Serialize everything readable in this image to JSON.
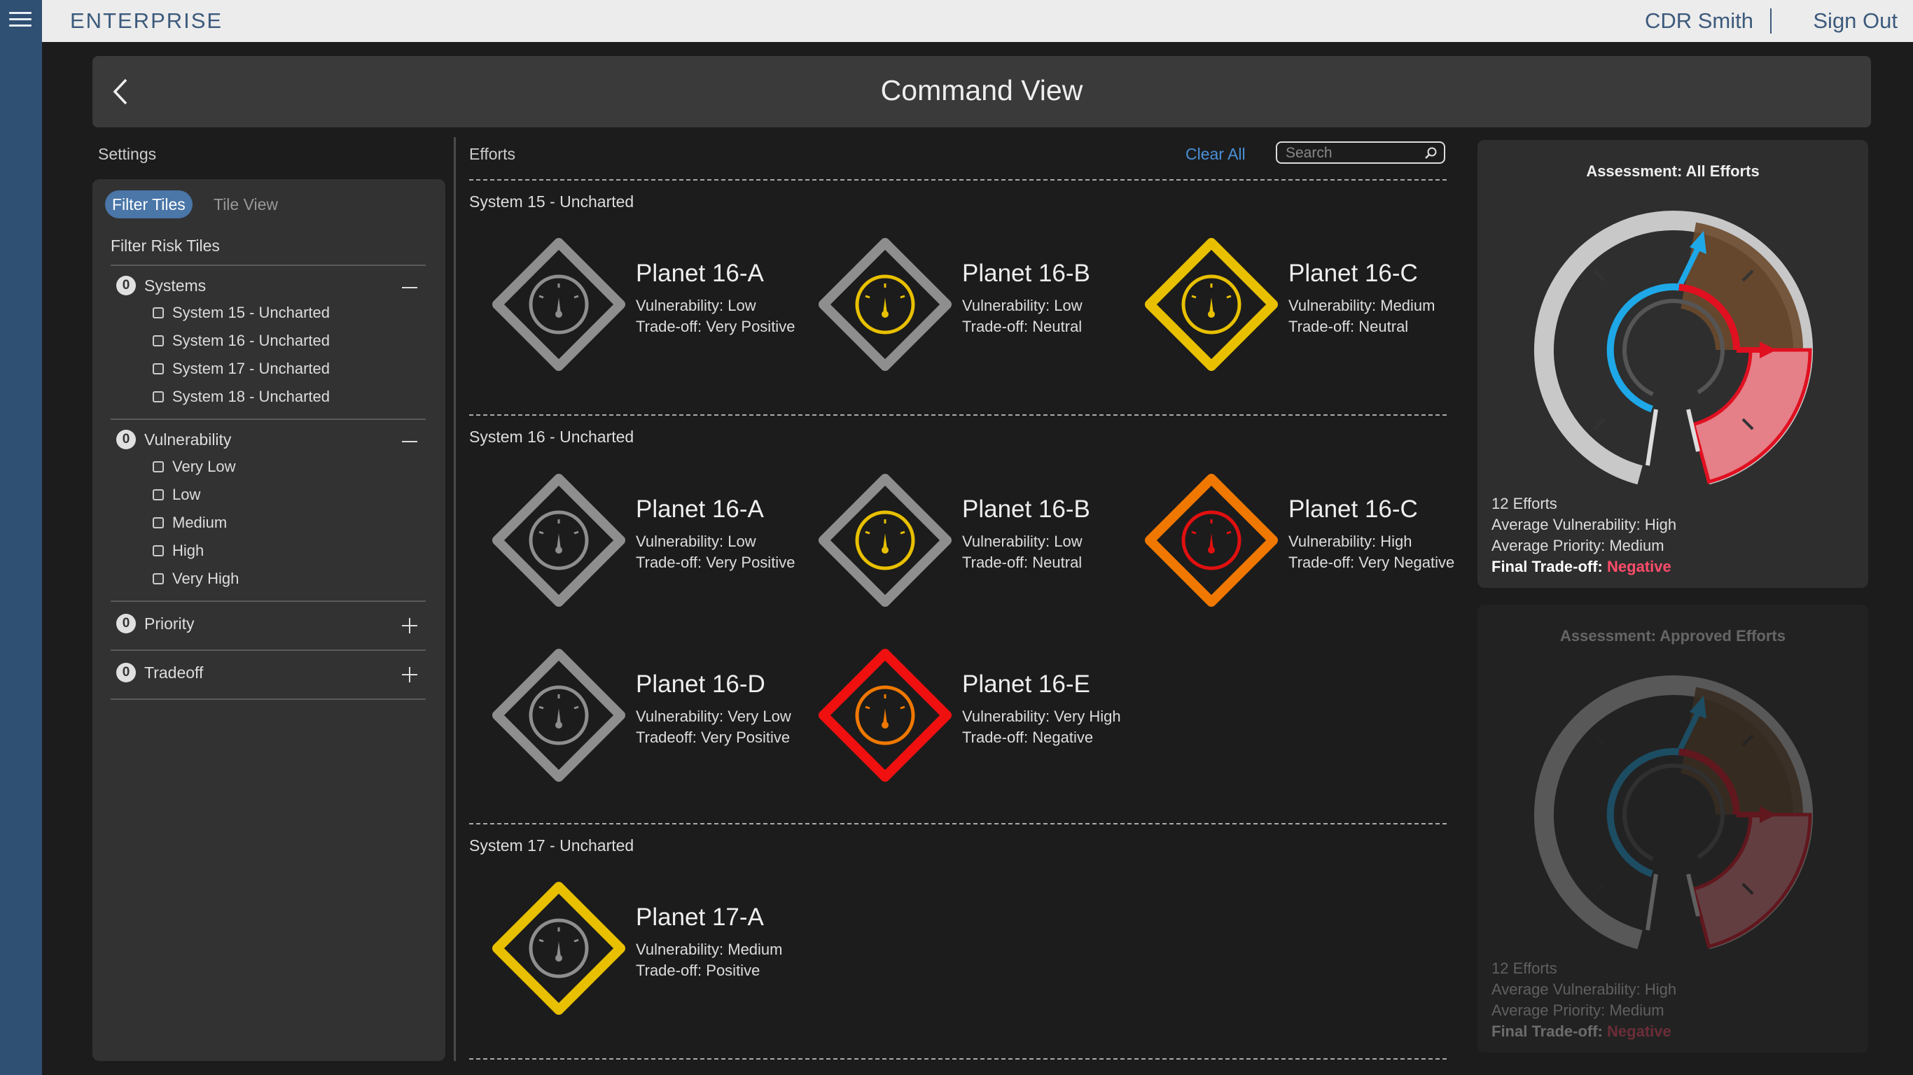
{
  "topbar": {
    "brand": "ENTERPRISE",
    "user": "CDR Smith",
    "signout": "Sign Out"
  },
  "header": {
    "title": "Command View"
  },
  "settings": {
    "label": "Settings",
    "tabs": {
      "active": "Filter Tiles",
      "inactive": "Tile View"
    },
    "filter_title": "Filter Risk Tiles",
    "groups": [
      {
        "count": "0",
        "label": "Systems",
        "expanded": true,
        "options": [
          "System 15 - Uncharted",
          "System 16 - Uncharted",
          "System 17 - Uncharted",
          "System 18 - Uncharted"
        ]
      },
      {
        "count": "0",
        "label": "Vulnerability",
        "expanded": true,
        "options": [
          "Very Low",
          "Low",
          "Medium",
          "High",
          "Very High"
        ]
      },
      {
        "count": "0",
        "label": "Priority",
        "expanded": false
      },
      {
        "count": "0",
        "label": "Tradeoff",
        "expanded": false
      }
    ]
  },
  "efforts": {
    "label": "Efforts",
    "clear_all": "Clear All",
    "search_placeholder": "Search",
    "systems": [
      {
        "label": "System 15 - Uncharted",
        "tiles": [
          {
            "name": "Planet 16-A",
            "line1": "Vulnerability: Low",
            "line2": "Trade-off: Very Positive",
            "outline": "#8e8e8e",
            "dial": "#8e8e8e"
          },
          {
            "name": "Planet 16-B",
            "line1": "Vulnerability: Low",
            "line2": "Trade-off: Neutral",
            "outline": "#8e8e8e",
            "dial": "#e8c000"
          },
          {
            "name": "Planet 16-C",
            "line1": "Vulnerability: Medium",
            "line2": "Trade-off: Neutral",
            "outline": "#e8c000",
            "dial": "#e8c000"
          }
        ]
      },
      {
        "label": "System 16 - Uncharted",
        "tiles": [
          {
            "name": "Planet 16-A",
            "line1": "Vulnerability: Low",
            "line2": "Trade-off: Very Positive",
            "outline": "#8e8e8e",
            "dial": "#8e8e8e"
          },
          {
            "name": "Planet 16-B",
            "line1": "Vulnerability: Low",
            "line2": "Trade-off: Neutral",
            "outline": "#8e8e8e",
            "dial": "#e8c000"
          },
          {
            "name": "Planet 16-C",
            "line1": "Vulnerability: High",
            "line2": "Trade-off: Very Negative",
            "outline": "#f07800",
            "dial": "#e01010"
          },
          {
            "name": "Planet 16-D",
            "line1": "Vulnerability: Very Low",
            "line2": "Tradeoff: Very Positive",
            "outline": "#8e8e8e",
            "dial": "#8e8e8e"
          },
          {
            "name": "Planet 16-E",
            "line1": "Vulnerability: Very High",
            "line2": "Trade-off: Negative",
            "outline": "#f01010",
            "dial": "#f07800"
          }
        ]
      },
      {
        "label": "System 17 - Uncharted",
        "tiles": [
          {
            "name": "Planet 17-A",
            "line1": "Vulnerability: Medium",
            "line2": "Trade-off: Positive",
            "outline": "#e8c000",
            "dial": "#8e8e8e"
          }
        ]
      }
    ]
  },
  "assessments": [
    {
      "title": "Assessment: All Efforts",
      "efforts": "12 Efforts",
      "vulnerability": "Average Vulnerability: High",
      "priority": "Average Priority: Medium",
      "final_label": "Final Trade-off:",
      "final_value": "Negative",
      "dimmed": false
    },
    {
      "title": "Assessment: Approved Efforts",
      "efforts": "12 Efforts",
      "vulnerability": "Average Vulnerability: High",
      "priority": "Average Priority: Medium",
      "final_label": "Final Trade-off:",
      "final_value": "Negative",
      "dimmed": true
    }
  ],
  "colors": {
    "accent": "#4a76a8",
    "link": "#4a90d9",
    "negative": "#ff4d6a",
    "gray": "#8e8e8e",
    "yellow": "#e8c000",
    "orange": "#f07800",
    "red": "#f01010",
    "blue": "#1ea8e8"
  }
}
